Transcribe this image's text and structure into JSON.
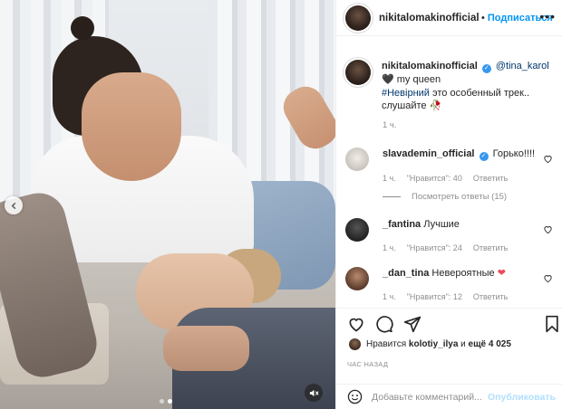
{
  "post": {
    "owner": "nikitalomakinofficial",
    "header_separator": "•",
    "follow_label": "Подписаться",
    "more_label": "•••",
    "caption": {
      "username": "nikitalomakinofficial",
      "mention": "@tina_karol",
      "heart": "🖤",
      "line1": "my queen",
      "hashtag": "#Невірний",
      "line2": "это особенный трек..",
      "line3": "слушайте",
      "emoji": "🥀",
      "time": "1 ч."
    },
    "comments": [
      {
        "username": "slavademin_official",
        "verified": true,
        "text": "Горько!!!!",
        "time": "1 ч.",
        "likes": "\"Нравится\": 40",
        "reply_label": "Ответить"
      },
      {
        "username": "_fantina",
        "verified": false,
        "text": "Лучшие",
        "time": "1 ч.",
        "likes": "\"Нравится\": 24",
        "reply_label": "Ответить"
      },
      {
        "username": "_dan_tina",
        "verified": false,
        "text": "Невероятные",
        "heart": "❤",
        "time": "1 ч.",
        "likes": "\"Нравится\": 12",
        "reply_label": "Ответить"
      }
    ],
    "view_replies": "Посмотреть ответы (15)",
    "likes_prefix": "Нравится",
    "likes_user": "kolotiy_ilya",
    "likes_middle": "и",
    "likes_rest": "ещё 4 025",
    "post_age": "ЧАС НАЗАД",
    "comment_placeholder": "Добавьте комментарий...",
    "publish_label": "Опубликовать",
    "verified_mark": "✓"
  },
  "carousel": {
    "total": 2,
    "active": 2
  },
  "colors": {
    "link": "#00376b",
    "follow": "#0095f6",
    "muted": "#8e8e8e",
    "like_red": "#ed4956"
  },
  "icons": [
    "chevron-left-icon",
    "mute-icon",
    "heart-icon",
    "comment-icon",
    "share-icon",
    "bookmark-icon",
    "emoji-icon"
  ]
}
